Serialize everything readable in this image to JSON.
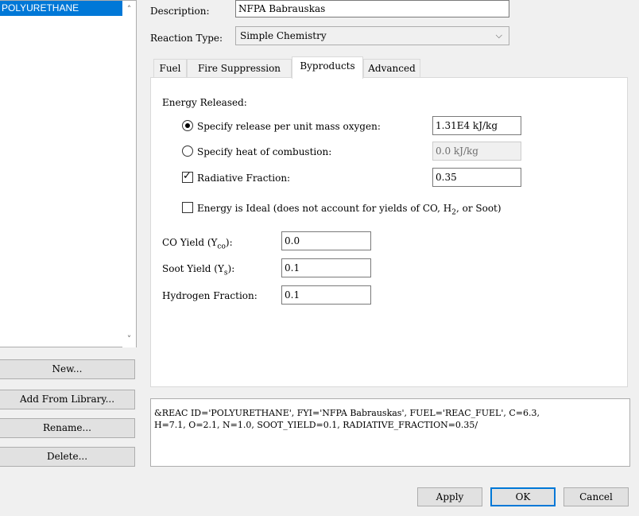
{
  "reactions_list": {
    "selected_item": "POLYURETHANE",
    "scroll_up_icon": "chevron-up-icon",
    "scroll_down_icon": "chevron-down-icon"
  },
  "left_buttons": {
    "new": "New...",
    "add_from_library": "Add From Library...",
    "rename": "Rename...",
    "delete": "Delete..."
  },
  "description": {
    "label": "Description:",
    "value": "NFPA Babrauskas"
  },
  "reaction_type": {
    "label": "Reaction Type:",
    "value": "Simple Chemistry",
    "icon": "chevron-down-icon"
  },
  "tabs": [
    {
      "label": "Fuel"
    },
    {
      "label": "Fire Suppression"
    },
    {
      "label": "Byproducts",
      "active": true
    },
    {
      "label": "Advanced"
    }
  ],
  "byproducts": {
    "energy_released_label": "Energy Released:",
    "specify_release_label": "Specify release per unit mass oxygen:",
    "specify_release_value": "1.31E4 kJ/kg",
    "specify_release_selected": true,
    "heat_of_combustion_label": "Specify heat of combustion:",
    "heat_of_combustion_value": "0.0 kJ/kg",
    "radiative_fraction_label": "Radiative Fraction:",
    "radiative_fraction_value": "0.35",
    "radiative_fraction_checked": true,
    "energy_ideal_label_main": "Energy is Ideal (does not account for yields of CO, H",
    "energy_ideal_label_sub": "2",
    "energy_ideal_label_tail": ", or Soot)",
    "energy_ideal_checked": false,
    "co_yield_label": "CO Yield (Y",
    "co_yield_sub": "co",
    "co_yield_tail": "):",
    "co_yield_value": "0.0",
    "soot_yield_label": "Soot Yield (Y",
    "soot_yield_sub": "s",
    "soot_yield_tail": "):",
    "soot_yield_value": "0.1",
    "hydrogen_fraction_label": "Hydrogen Fraction:",
    "hydrogen_fraction_value": "0.1"
  },
  "namelist": "&REAC ID='POLYURETHANE', FYI='NFPA Babrauskas', FUEL='REAC_FUEL', C=6.3,\nH=7.1, O=2.1, N=1.0, SOOT_YIELD=0.1, RADIATIVE_FRACTION=0.35/",
  "bottom_buttons": {
    "apply": "Apply",
    "ok": "OK",
    "cancel": "Cancel"
  }
}
